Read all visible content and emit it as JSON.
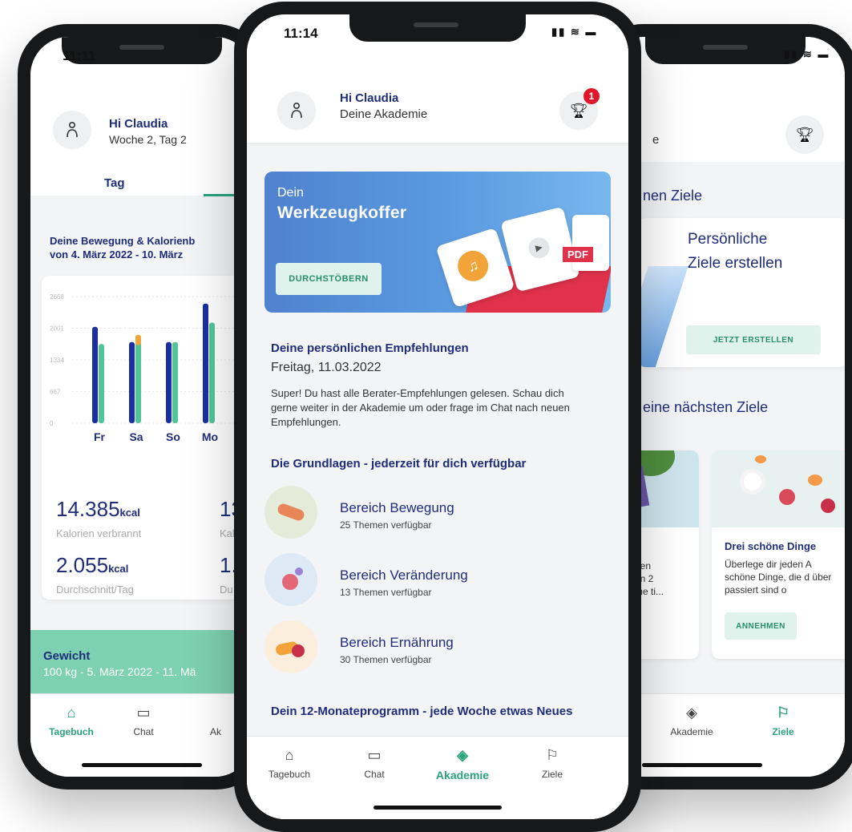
{
  "left_phone": {
    "time": "11:11",
    "greeting": "Hi Claudia",
    "subtitle": "Woche 2, Tag 2",
    "tab_day": "Tag",
    "chart_title_line1": "Deine Bewegung & Kalorienb",
    "chart_title_line2": "von 4. März 2022 - 10. März",
    "kcal_burned_value": "14.385",
    "kcal_burned_unit": "kcal",
    "kcal_burned_label": "Kalorien verbrannt",
    "kcal_avg_value": "2.055",
    "kcal_avg_unit": "kcal",
    "kcal_avg_label": "Durchschnitt/Tag",
    "partial_value_1": "13",
    "partial_label_1": "Kal",
    "partial_value_2": "1.9",
    "partial_label_2": "Du",
    "weight_title": "Gewicht",
    "weight_subtitle": "100 kg - 5. März 2022 - 11. Mä",
    "tabs": [
      {
        "icon": "home-icon",
        "label": "Tagebuch",
        "active": true
      },
      {
        "icon": "chat-icon",
        "label": "Chat",
        "active": false
      },
      {
        "icon": "academy-icon",
        "label": "Ak",
        "active": false
      }
    ]
  },
  "chart_data": {
    "type": "bar",
    "categories": [
      "Fr",
      "Sa",
      "So",
      "Mo"
    ],
    "yticks": [
      "2668",
      "2001",
      "1334",
      "667",
      "0"
    ],
    "ylim": [
      0,
      2668
    ],
    "series": [
      {
        "color": "#1b2fa0",
        "values": [
          2030,
          1710,
          1710,
          2520
        ]
      },
      {
        "color": "#52c49a",
        "values": [
          1670,
          1710,
          1710,
          2120
        ]
      },
      {
        "color": "#f2a33a",
        "values": [
          0,
          220,
          0,
          0
        ]
      }
    ]
  },
  "center_phone": {
    "time": "11:14",
    "greeting": "Hi Claudia",
    "subtitle": "Deine Akademie",
    "trophy_badge": "1",
    "banner_line1": "Dein",
    "banner_line2": "Werkzeugkoffer",
    "banner_button": "DURCHSTÖBERN",
    "banner_pdf": "PDF",
    "recs_title": "Deine persönlichen Empfehlungen",
    "recs_date": "Freitag, 11.03.2022",
    "recs_text": "Super! Du hast alle Berater-Empfehlungen gelesen. Schau dich gerne weiter in der Akademie um oder frage im Chat nach neuen Empfehlungen.",
    "basics_title": "Die Grundlagen - jederzeit für dich verfügbar",
    "bereiche": [
      {
        "title": "Bereich Bewegung",
        "sub": "25 Themen verfügbar",
        "bg": "#e4ecd9"
      },
      {
        "title": "Bereich Veränderung",
        "sub": "13 Themen verfügbar",
        "bg": "#dde9f5"
      },
      {
        "title": "Bereich Ernährung",
        "sub": "30 Themen verfügbar",
        "bg": "#fbeedd"
      }
    ],
    "program_title": "Dein 12-Monateprogramm - jede Woche etwas Neues",
    "tabs": [
      {
        "icon": "home-icon",
        "label": "Tagebuch",
        "active": false
      },
      {
        "icon": "chat-icon",
        "label": "Chat",
        "active": false
      },
      {
        "icon": "academy-icon",
        "label": "Akademie",
        "active": true
      },
      {
        "icon": "flag-icon",
        "label": "Ziele",
        "active": false
      }
    ]
  },
  "right_phone": {
    "subtitle_fragment": "e",
    "goals_heading": "nen Ziele",
    "create_title_1": "Persönliche",
    "create_title_2": "Ziele erstellen",
    "create_button": "JETZT ERSTELLEN",
    "next_heading": "eine nächsten Ziele",
    "card1_lines": [
      "gen",
      "en 2",
      "me ti..."
    ],
    "card2_title": "Drei schöne Dinge",
    "card2_text": "Überlege dir jeden A schöne Dinge, die d über passiert sind o",
    "card2_button": "ANNEHMEN",
    "tabs": [
      {
        "icon": "academy-icon",
        "label": "Akademie",
        "active": false
      },
      {
        "icon": "flag-icon",
        "label": "Ziele",
        "active": true
      }
    ]
  }
}
